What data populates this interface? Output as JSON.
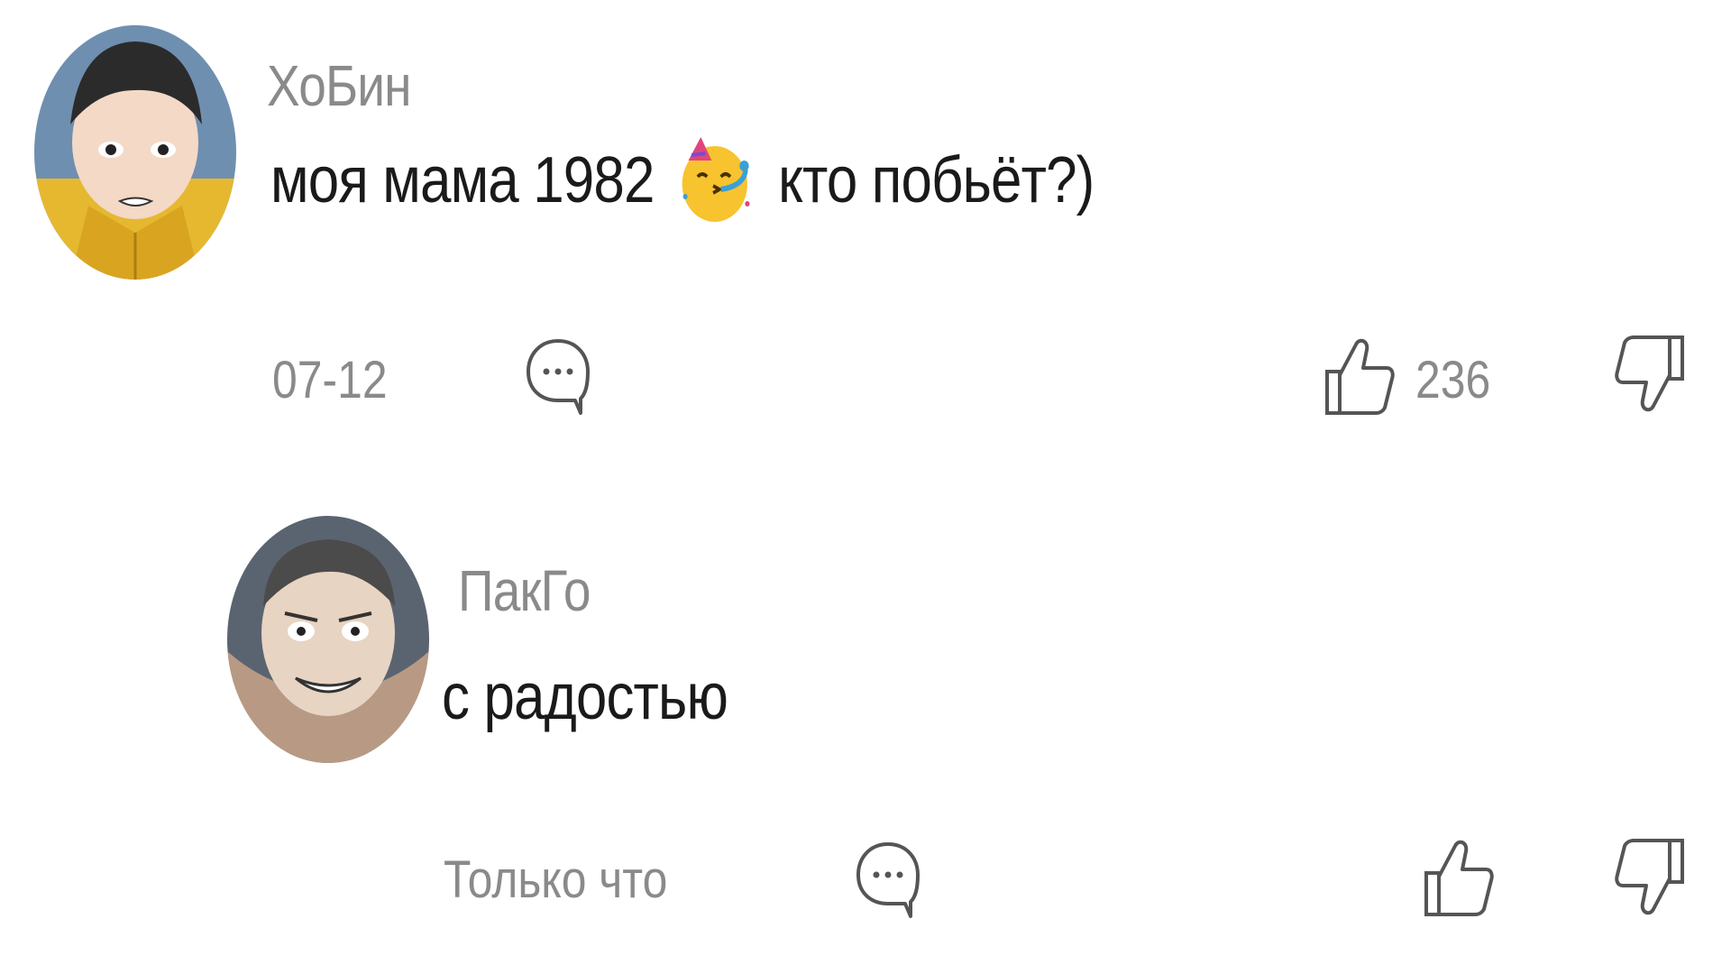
{
  "comments": [
    {
      "username": "ХоБин",
      "text_before": "моя мама 1982",
      "emoji": "partying-face-icon",
      "text_after": "кто побьёт?)",
      "date": "07-12",
      "likes": "236"
    },
    {
      "username": "ПакГо",
      "text": "с радостью",
      "date": "Только что"
    }
  ],
  "colors": {
    "primary_text": "#1a1a1a",
    "secondary_text": "#8a8a8a",
    "icon_stroke": "#555555"
  }
}
